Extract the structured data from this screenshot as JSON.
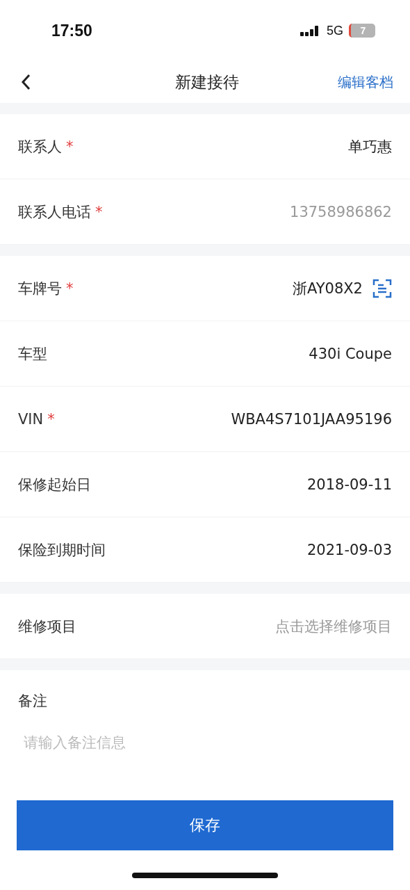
{
  "status_bar": {
    "time": "17:50",
    "network": "5G",
    "battery": "7"
  },
  "header": {
    "title": "新建接待",
    "action": "编辑客档"
  },
  "groups": [
    {
      "rows": [
        {
          "kind": "text",
          "label": "联系人",
          "required_mark": "*",
          "value": "单巧惠",
          "disabled": false
        },
        {
          "kind": "text",
          "label": "联系人电话",
          "required_mark": "*",
          "value": "13758986862",
          "disabled": true
        }
      ]
    },
    {
      "rows": [
        {
          "kind": "scan",
          "label": "车牌号",
          "required_mark": "*",
          "value": "浙AY08X2"
        },
        {
          "kind": "text",
          "label": "车型",
          "value": "430i Coupe"
        },
        {
          "kind": "text",
          "label": "VIN",
          "required_mark": "*",
          "value": "WBA4S7101JAA95196"
        },
        {
          "kind": "text",
          "label": "保修起始日",
          "value": "2018-09-11"
        },
        {
          "kind": "text",
          "label": "保险到期时间",
          "value": "2021-09-03"
        }
      ]
    },
    {
      "rows": [
        {
          "kind": "select",
          "label": "维修项目",
          "placeholder": "点击选择维修项目"
        }
      ]
    }
  ],
  "remark": {
    "label": "备注",
    "placeholder": "请输入备注信息"
  },
  "save_button": "保存"
}
